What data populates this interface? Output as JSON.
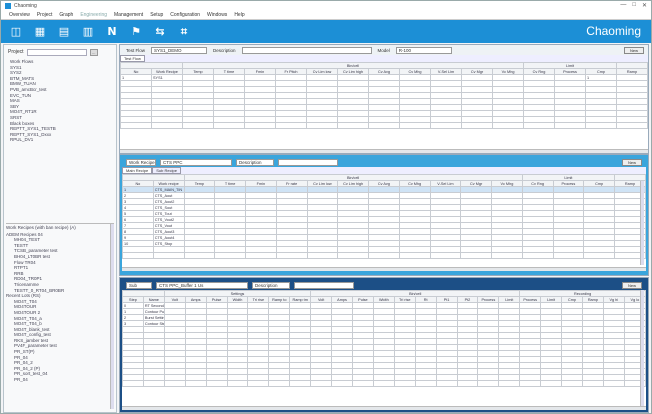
{
  "window": {
    "title": "Chaoming",
    "controls": [
      "—",
      "□",
      "✕"
    ]
  },
  "menu": [
    "Overview",
    "Project",
    "Graph",
    "Engineering",
    "Management",
    "Setup",
    "Configuration",
    "Windows",
    "Help"
  ],
  "toolbar": {
    "icons": [
      "grid-icon",
      "table-icon",
      "layers-icon",
      "chart-icon",
      "n-icon",
      "flag-icon",
      "connect-icon",
      "code-icon"
    ],
    "glyphs": [
      "◫",
      "▦",
      "▤",
      "▥",
      "N",
      "⚑",
      "⇆",
      "⌗"
    ],
    "brand": "Chaoming",
    "accent": "#1c8fd6"
  },
  "left": {
    "project_label": "Project",
    "tree": [
      "Work Flows",
      "SYS1",
      "SYS2",
      "BTM_MATS",
      "BMW_TUAN",
      "PVB_amcBcr_test",
      "EVC_TUN",
      "MAS",
      "SBY",
      "MO4T_RT1R",
      "SRST",
      "Black boxes",
      "REPTT_SYS1_TESTB",
      "REPTT_SYS1_Dxxx",
      "RPUL_DV1"
    ],
    "tree2_title": "Work Recipes (with ban recipe) (A)",
    "tree2": [
      {
        "name": "ADEM Recipes 04",
        "children": [
          "MH04_TEST",
          "TESTT",
          "TCSB_parameter test",
          "BH04_LT0BR test",
          "Flow TR04",
          "RTPT1",
          "RRB",
          "RD04_TR0P1",
          "Tricenamme",
          "TESTT_0_RT04_BR0BR"
        ]
      },
      {
        "name": "Recent Lots (RS)",
        "children": [
          "MO4T_T04",
          "MO4TOUR",
          "MO4TOUR 2",
          "MO4T_T04_a",
          "MO4T_T04_b",
          "MO4T_blank_test",
          "MO4T_config_test",
          "RKS_jamber test",
          "PV4F_parameter test",
          "PR_ST(P)",
          "PR_04",
          "PR_04_2",
          "PR_04_2 (P)",
          "PR_sort_test_04",
          "PR_04"
        ]
      }
    ]
  },
  "panel1": {
    "test_flow_label": "Test Flow",
    "test_flow_value": "SYS1_DEMO",
    "desc_label": "Description",
    "model_label": "Model",
    "model_value": "R-100",
    "new_btn": "New",
    "tab": "Test Flow",
    "group_header": "Bin/cell",
    "group_header2": "Limit",
    "columns": [
      "No",
      "Work Recipe",
      "Temp",
      "T time",
      "Fmin",
      "Fr Pitch",
      "Cv Lim low",
      "Cv Lim high",
      "Cv Avg",
      "Cv Mhg",
      "V-Sel Lim",
      "Cv Mgr",
      "Vc Mhg",
      "Cv Rng",
      "Process",
      "Cmp",
      "Ramp"
    ],
    "rows": [
      [
        "1",
        "SYS1",
        "",
        "",
        "",
        "",
        "",
        "",
        "",
        "",
        "",
        "",
        "",
        "",
        "",
        "1",
        ""
      ]
    ]
  },
  "panel2": {
    "label": "Work Recipe",
    "value": "CTS PPC",
    "desc_label": "Description",
    "new_btn": "New",
    "tabs": [
      "Main Recipe",
      "Sub Recipe"
    ],
    "group_header": "Bin/cell",
    "group_header2": "Limit",
    "columns": [
      "No",
      "Work recipe",
      "Temp",
      "T time",
      "Fmin",
      "Fr rate",
      "Cv Lim low",
      "Cv Lim high",
      "Cv Avg",
      "Cv Mhg",
      "V-Sel Lim",
      "Cv Mgr",
      "Vc Mhg",
      "Cv Rng",
      "Process",
      "Cmp",
      "Ramp"
    ],
    "rows": [
      [
        "1",
        "CTS_MAIN_TIN"
      ],
      [
        "2",
        "CTS_Aout"
      ],
      [
        "3",
        "CTS_Aout2"
      ],
      [
        "4",
        "CTS_Sout"
      ],
      [
        "5",
        "CTS_Tout"
      ],
      [
        "6",
        "CTS_Vout2"
      ],
      [
        "7",
        "CTS_Vout"
      ],
      [
        "8",
        "CTS_Aout3"
      ],
      [
        "9",
        "CTS_Aout4"
      ],
      [
        "10",
        "CTS_Stop"
      ]
    ]
  },
  "panel3": {
    "label": "Sub Recipe",
    "value": "CTS PPC_Buffer 1 Us",
    "desc_label": "Description",
    "new_btn": "New",
    "group1": "Settings",
    "group2": "Bin/cell",
    "group3": "Recording",
    "columns": [
      "Step",
      "Name",
      "Volt",
      "Amps",
      "Pulse",
      "Width",
      "Tri rise",
      "Ramp to",
      "Ramp tm",
      "Volt",
      "Amps",
      "Pulse",
      "Width",
      "Tri rise",
      "Rt",
      "Pt1",
      "Pt2",
      "Process",
      "Limit",
      "Process",
      "Limit",
      "Cmp",
      "Ramp",
      "Vg hi",
      "Vg lo"
    ],
    "rows": [
      [
        "0",
        "RT Secondary",
        "",
        "",
        "",
        "",
        "",
        "",
        "",
        "",
        "",
        "",
        "",
        "",
        "",
        "",
        "",
        "",
        "",
        "",
        "",
        "",
        "",
        "",
        ""
      ],
      [
        "1",
        "Contour Pulse",
        "",
        "",
        "",
        "",
        "",
        "",
        "",
        "",
        "",
        "",
        "",
        "",
        "",
        "",
        "",
        "",
        "",
        "",
        "",
        "",
        "",
        "",
        ""
      ],
      [
        "2",
        "Burst Setting",
        "",
        "",
        "",
        "",
        "",
        "",
        "",
        "",
        "",
        "",
        "",
        "",
        "",
        "",
        "",
        "",
        "",
        "",
        "",
        "",
        "",
        "",
        ""
      ],
      [
        "3",
        "Contour Step",
        "",
        "",
        "",
        "",
        "",
        "",
        "",
        "",
        "",
        "",
        "",
        "",
        "",
        "",
        "",
        "",
        "",
        "",
        "",
        "",
        "",
        "",
        ""
      ]
    ]
  }
}
